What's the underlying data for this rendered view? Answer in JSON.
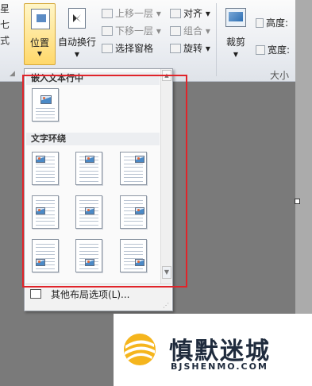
{
  "ribbon": {
    "left_strip": [
      "星",
      "七",
      "式"
    ],
    "position_label": "位置",
    "wrap_text_label": "自动换行",
    "bring_forward": "上移一层",
    "send_backward": "下移一层",
    "selection_pane": "选择窗格",
    "align": "对齐",
    "group": "组合",
    "rotate": "旋转",
    "crop": "裁剪",
    "height": "高度:",
    "width": "宽度:",
    "size_group": "大小"
  },
  "dropdown": {
    "section_inline": "嵌入文本行中",
    "section_wrap": "文字环绕",
    "more_options": "其他布局选项(L)...",
    "thumbnails": [
      {
        "row": 1,
        "col": 1
      },
      {
        "row": 1,
        "col": 2
      },
      {
        "row": 1,
        "col": 3
      },
      {
        "row": 2,
        "col": 1
      },
      {
        "row": 2,
        "col": 2
      },
      {
        "row": 2,
        "col": 3
      },
      {
        "row": 3,
        "col": 1
      },
      {
        "row": 3,
        "col": 2
      },
      {
        "row": 3,
        "col": 3
      }
    ]
  },
  "watermark": {
    "cn": "慎默迷城",
    "en": "BJSHENMO.COM"
  },
  "colors": {
    "highlight_box": "#e0242a",
    "active_button": "#ffd86a"
  }
}
